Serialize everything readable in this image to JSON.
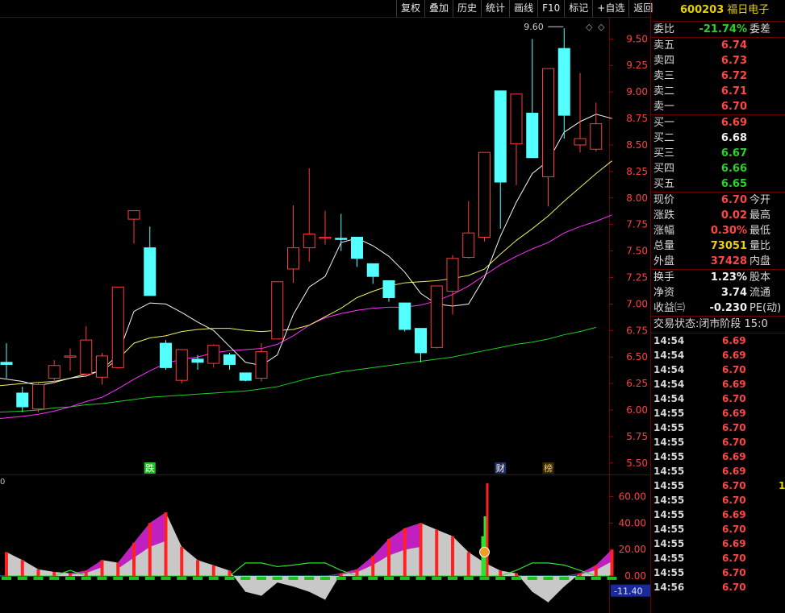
{
  "toolbar": [
    "复权",
    "叠加",
    "历史",
    "统计",
    "画线",
    "F10",
    "标记",
    "+自选",
    "返回"
  ],
  "stock": {
    "code": "600203",
    "name": "福日电子"
  },
  "weibi": {
    "label": "委比",
    "value": "-21.74%",
    "label2": "委差"
  },
  "asks": [
    {
      "label": "卖五",
      "price": "6.74"
    },
    {
      "label": "卖四",
      "price": "6.73"
    },
    {
      "label": "卖三",
      "price": "6.72"
    },
    {
      "label": "卖二",
      "price": "6.71"
    },
    {
      "label": "卖一",
      "price": "6.70"
    }
  ],
  "bids": [
    {
      "label": "买一",
      "price": "6.69"
    },
    {
      "label": "买二",
      "price": "6.68"
    },
    {
      "label": "买三",
      "price": "6.67"
    },
    {
      "label": "买四",
      "price": "6.66"
    },
    {
      "label": "买五",
      "price": "6.65"
    }
  ],
  "quote": [
    {
      "label": "现价",
      "value": "6.70",
      "label2": "今开",
      "color": "red"
    },
    {
      "label": "涨跌",
      "value": "0.02",
      "label2": "最高",
      "color": "red"
    },
    {
      "label": "涨幅",
      "value": "0.30%",
      "label2": "最低",
      "color": "red"
    },
    {
      "label": "总量",
      "value": "73051",
      "label2": "量比",
      "color": "yellow"
    },
    {
      "label": "外盘",
      "value": "37428",
      "label2": "内盘",
      "color": "red"
    }
  ],
  "fin": [
    {
      "label": "换手",
      "value": "1.23%",
      "label2": "股本"
    },
    {
      "label": "净资",
      "value": "3.74",
      "label2": "流通"
    },
    {
      "label": "收益㈢",
      "value": "-0.230",
      "label2": "PE(动)"
    }
  ],
  "status": {
    "label": "交易状态:",
    "value": "闭市阶段 15:0"
  },
  "ticks": [
    {
      "t": "14:54",
      "p": "6.69",
      "v": ""
    },
    {
      "t": "14:54",
      "p": "6.69",
      "v": ""
    },
    {
      "t": "14:54",
      "p": "6.70",
      "v": ""
    },
    {
      "t": "14:54",
      "p": "6.69",
      "v": ""
    },
    {
      "t": "14:54",
      "p": "6.70",
      "v": ""
    },
    {
      "t": "14:55",
      "p": "6.69",
      "v": ""
    },
    {
      "t": "14:55",
      "p": "6.70",
      "v": ""
    },
    {
      "t": "14:55",
      "p": "6.70",
      "v": ""
    },
    {
      "t": "14:55",
      "p": "6.69",
      "v": ""
    },
    {
      "t": "14:55",
      "p": "6.69",
      "v": ""
    },
    {
      "t": "14:55",
      "p": "6.70",
      "v": "1"
    },
    {
      "t": "14:55",
      "p": "6.70",
      "v": ""
    },
    {
      "t": "14:55",
      "p": "6.69",
      "v": ""
    },
    {
      "t": "14:55",
      "p": "6.70",
      "v": ""
    },
    {
      "t": "14:55",
      "p": "6.69",
      "v": ""
    },
    {
      "t": "14:55",
      "p": "6.70",
      "v": ""
    },
    {
      "t": "14:55",
      "p": "6.70",
      "v": ""
    },
    {
      "t": "14:56",
      "p": "6.70",
      "v": ""
    }
  ],
  "colors": {
    "up": "#ff3a3a",
    "down": "#54ffff",
    "ma5": "#f5f5f5",
    "ma10": "#f0f060",
    "ma20": "#ff30ff",
    "ma60": "#20d020"
  },
  "chart_data": {
    "type": "candlestick",
    "y_ticks": [
      "9.50",
      "9.25",
      "9.00",
      "8.75",
      "8.50",
      "8.25",
      "8.00",
      "7.75",
      "7.50",
      "7.25",
      "7.00",
      "6.75",
      "6.50",
      "6.25",
      "6.00",
      "5.75",
      "5.50"
    ],
    "ylim": [
      5.4,
      9.7
    ],
    "candles": [
      {
        "o": 6.45,
        "c": 6.43,
        "h": 6.63,
        "l": 6.3
      },
      {
        "o": 6.16,
        "c": 6.03,
        "h": 6.22,
        "l": 5.98
      },
      {
        "o": 6.01,
        "c": 6.24,
        "h": 6.26,
        "l": 5.98
      },
      {
        "o": 6.3,
        "c": 6.42,
        "h": 6.47,
        "l": 6.25
      },
      {
        "o": 6.51,
        "c": 6.51,
        "h": 6.58,
        "l": 6.37
      },
      {
        "o": 6.34,
        "c": 6.66,
        "h": 6.79,
        "l": 6.31
      },
      {
        "o": 6.31,
        "c": 6.51,
        "h": 6.54,
        "l": 6.24
      },
      {
        "o": 6.4,
        "c": 7.16,
        "h": 7.16,
        "l": 6.4
      },
      {
        "o": 7.8,
        "c": 7.88,
        "h": 7.88,
        "l": 7.57
      },
      {
        "o": 7.53,
        "c": 7.08,
        "h": 7.73,
        "l": 7.08
      },
      {
        "o": 6.63,
        "c": 6.4,
        "h": 6.66,
        "l": 6.38
      },
      {
        "o": 6.28,
        "c": 6.57,
        "h": 6.57,
        "l": 6.25
      },
      {
        "o": 6.48,
        "c": 6.45,
        "h": 6.52,
        "l": 6.38
      },
      {
        "o": 6.44,
        "c": 6.61,
        "h": 6.62,
        "l": 6.4
      },
      {
        "o": 6.52,
        "c": 6.43,
        "h": 6.54,
        "l": 6.38
      },
      {
        "o": 6.35,
        "c": 6.28,
        "h": 6.35,
        "l": 6.27
      },
      {
        "o": 6.3,
        "c": 6.55,
        "h": 6.63,
        "l": 6.27
      },
      {
        "o": 6.67,
        "c": 7.21,
        "h": 7.21,
        "l": 6.67
      },
      {
        "o": 7.33,
        "c": 7.53,
        "h": 7.93,
        "l": 7.2
      },
      {
        "o": 7.53,
        "c": 7.66,
        "h": 8.28,
        "l": 7.4
      },
      {
        "o": 7.63,
        "c": 7.63,
        "h": 7.88,
        "l": 7.56
      },
      {
        "o": 7.62,
        "c": 7.61,
        "h": 7.85,
        "l": 7.5
      },
      {
        "o": 7.63,
        "c": 7.43,
        "h": 7.63,
        "l": 7.35
      },
      {
        "o": 7.38,
        "c": 7.26,
        "h": 7.38,
        "l": 7.19
      },
      {
        "o": 7.22,
        "c": 7.06,
        "h": 7.22,
        "l": 7.02
      },
      {
        "o": 7.01,
        "c": 6.76,
        "h": 7.01,
        "l": 6.74
      },
      {
        "o": 6.77,
        "c": 6.54,
        "h": 6.77,
        "l": 6.45
      },
      {
        "o": 6.59,
        "c": 7.17,
        "h": 7.17,
        "l": 6.58
      },
      {
        "o": 7.12,
        "c": 7.43,
        "h": 7.46,
        "l": 6.9
      },
      {
        "o": 7.44,
        "c": 7.67,
        "h": 7.97,
        "l": 7.43
      },
      {
        "o": 7.63,
        "c": 8.43,
        "h": 8.43,
        "l": 7.59
      },
      {
        "o": 9.01,
        "c": 8.15,
        "h": 9.01,
        "l": 7.71
      },
      {
        "o": 8.51,
        "c": 8.98,
        "h": 8.98,
        "l": 8.12
      },
      {
        "o": 8.8,
        "c": 8.38,
        "h": 9.5,
        "l": 8.38
      },
      {
        "o": 8.2,
        "c": 9.22,
        "h": 9.22,
        "l": 7.92
      },
      {
        "o": 9.41,
        "c": 8.78,
        "h": 9.6,
        "l": 8.56
      },
      {
        "o": 8.5,
        "c": 8.56,
        "h": 9.18,
        "l": 8.43
      },
      {
        "o": 8.46,
        "c": 8.7,
        "h": 8.9,
        "l": 8.44
      }
    ],
    "high_annotation": "9.60",
    "events": [
      "跌",
      "财",
      "榜"
    ],
    "ma5": [
      6.3,
      6.27,
      6.23,
      6.26,
      6.3,
      6.32,
      6.38,
      6.52,
      6.93,
      7.01,
      7.0,
      6.92,
      6.83,
      6.75,
      6.6,
      6.45,
      6.42,
      6.52,
      6.9,
      7.16,
      7.26,
      7.58,
      7.62,
      7.55,
      7.45,
      7.3,
      7.1,
      7.0,
      6.98,
      7.0,
      7.25,
      7.64,
      7.96,
      8.23,
      8.35,
      8.62,
      8.72,
      8.79,
      8.75
    ],
    "ma10": [
      6.23,
      6.25,
      6.26,
      6.27,
      6.3,
      6.34,
      6.37,
      6.48,
      6.63,
      6.68,
      6.7,
      6.74,
      6.76,
      6.77,
      6.77,
      6.75,
      6.74,
      6.75,
      6.76,
      6.8,
      6.88,
      6.96,
      7.06,
      7.12,
      7.17,
      7.2,
      7.21,
      7.22,
      7.24,
      7.27,
      7.33,
      7.47,
      7.6,
      7.71,
      7.83,
      7.97,
      8.1,
      8.23,
      8.35
    ],
    "ma20": [
      5.92,
      5.94,
      5.96,
      5.99,
      6.03,
      6.08,
      6.12,
      6.2,
      6.29,
      6.37,
      6.44,
      6.48,
      6.5,
      6.54,
      6.56,
      6.57,
      6.58,
      6.62,
      6.7,
      6.8,
      6.87,
      6.91,
      6.94,
      6.96,
      6.97,
      6.97,
      6.99,
      7.03,
      7.09,
      7.17,
      7.27,
      7.37,
      7.45,
      7.52,
      7.58,
      7.67,
      7.73,
      7.78,
      7.84
    ],
    "ma60": [
      5.98,
      5.99,
      6.0,
      6.02,
      6.03,
      6.05,
      6.06,
      6.08,
      6.1,
      6.12,
      6.13,
      6.14,
      6.15,
      6.16,
      6.17,
      6.18,
      6.2,
      6.22,
      6.26,
      6.3,
      6.33,
      6.36,
      6.38,
      6.4,
      6.42,
      6.44,
      6.46,
      6.48,
      6.5,
      6.53,
      6.56,
      6.59,
      6.62,
      6.64,
      6.67,
      6.71,
      6.74,
      6.78
    ],
    "indicator": {
      "y_ticks": [
        "60.00",
        "40.00",
        "20.00",
        "0.00",
        "-11.40"
      ],
      "ylim": [
        -25,
        70
      ],
      "bars": [
        18,
        12,
        5,
        3,
        2,
        4,
        12,
        10,
        25,
        40,
        48,
        22,
        12,
        8,
        4,
        -12,
        -15,
        -5,
        -8,
        -12,
        -18,
        2,
        5,
        15,
        28,
        36,
        40,
        35,
        30,
        18,
        10,
        4,
        2,
        -12,
        -20,
        -8,
        2,
        8,
        20
      ],
      "spike_index": 30,
      "spike_values": [
        30,
        45,
        70
      ]
    }
  }
}
